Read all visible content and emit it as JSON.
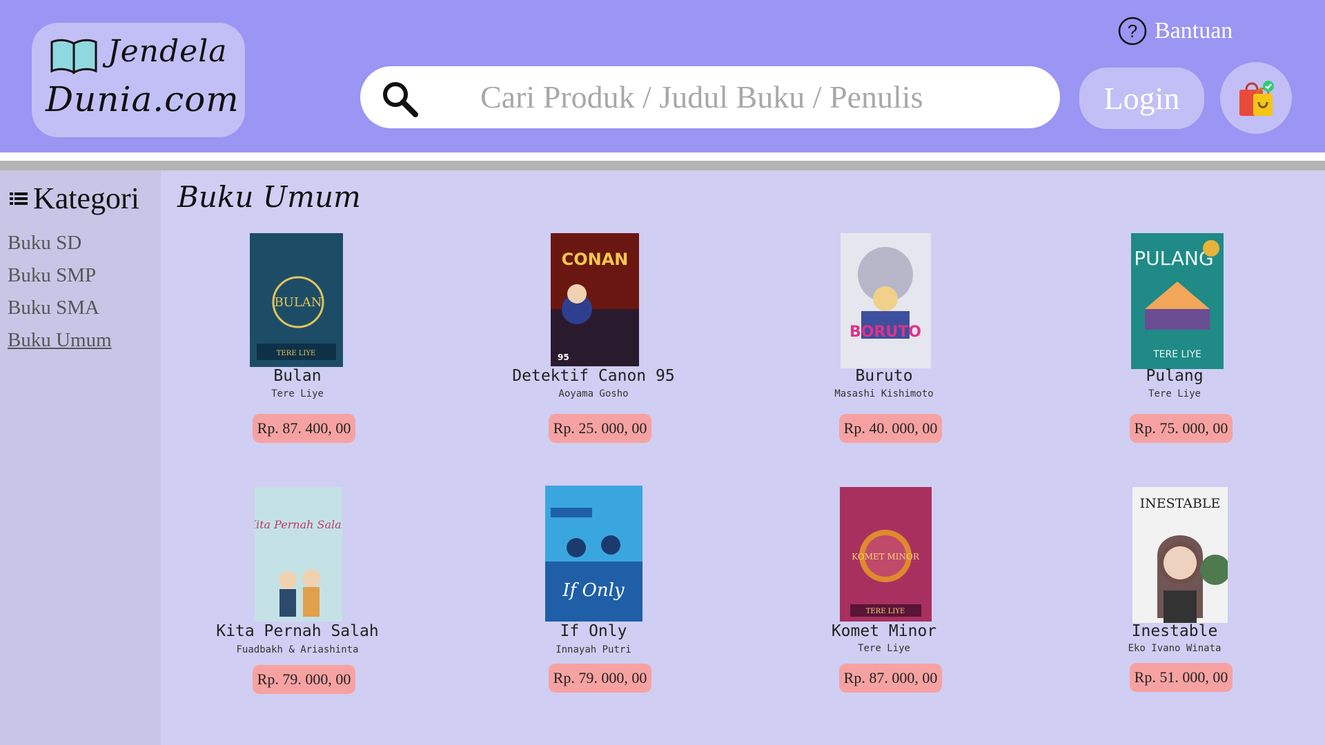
{
  "header": {
    "logo_line1": "Jendela",
    "logo_line2": "Dunia.com",
    "search_placeholder": "Cari Produk / Judul Buku / Penulis",
    "help_label": "Bantuan",
    "login_label": "Login"
  },
  "sidebar": {
    "title": "Kategori",
    "items": [
      {
        "label": "Buku SD",
        "active": false
      },
      {
        "label": "Buku SMP",
        "active": false
      },
      {
        "label": "Buku SMA",
        "active": false
      },
      {
        "label": "Buku Umum",
        "active": true
      }
    ]
  },
  "main": {
    "section_title": "Buku Umum",
    "products": [
      {
        "title": "Bulan",
        "author": "Tere Liye",
        "price": "Rp. 87. 400, 00",
        "cover_text": "BULAN",
        "cover_colors": [
          "#1f4e66",
          "#0e3147"
        ]
      },
      {
        "title": "Detektif Canon 95",
        "author": "Aoyama Gosho",
        "price": "Rp. 25. 000, 00",
        "cover_text": "CONAN",
        "cover_colors": [
          "#7a1a12",
          "#2a1a2e"
        ]
      },
      {
        "title": "Buruto",
        "author": "Masashi Kishimoto",
        "price": "Rp. 40. 000, 00",
        "cover_text": "BORUTO",
        "cover_colors": [
          "#e9e9ef",
          "#9b9bb5"
        ]
      },
      {
        "title": "Pulang",
        "author": "Tere Liye",
        "price": "Rp. 75. 000, 00",
        "cover_text": "PULANG",
        "cover_colors": [
          "#1f8a86",
          "#0d5a66"
        ]
      },
      {
        "title": "Kita Pernah Salah",
        "author": "Fuadbakh & Ariashinta",
        "price": "Rp. 79. 000, 00",
        "cover_text": "Kita Pernah Salah",
        "cover_colors": [
          "#c8e3e6",
          "#9ccbd0"
        ]
      },
      {
        "title": "If Only",
        "author": "Innayah Putri",
        "price": "Rp. 79. 000, 00",
        "cover_text": "If Only",
        "cover_colors": [
          "#3aa6e0",
          "#1e5fa8"
        ]
      },
      {
        "title": "Komet Minor",
        "author": "Tere Liye",
        "price": "Rp. 87. 000, 00",
        "cover_text": "KOMET MINOR",
        "cover_colors": [
          "#b0336a",
          "#5a1436"
        ]
      },
      {
        "title": "Inestable",
        "author": "Eko Ivano Winata",
        "price": "Rp. 51. 000, 00",
        "cover_text": "INESTABLE",
        "cover_colors": [
          "#f2f2f2",
          "#5c7a5c"
        ]
      }
    ]
  },
  "colors": {
    "header_bg": "#9b95f3",
    "pill_bg": "#c2bff6",
    "sidebar_bg": "#c8c5e6",
    "main_bg": "#d0cef3",
    "price_bg": "#f7a2a2"
  }
}
